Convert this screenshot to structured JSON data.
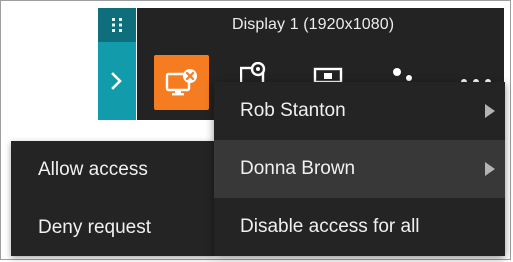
{
  "toolbar": {
    "display_title": "Display 1 (1920x1080)",
    "colors": {
      "bar": "#232323",
      "rail_dark": "#0e6e7c",
      "rail_light": "#129baa",
      "accent": "#f57c20"
    },
    "icons": [
      "drag-handle-icon",
      "expand-chevron-icon",
      "screen-share-blocked-icon",
      "settings-icon",
      "screen-icon",
      "users-icon",
      "more-icon"
    ]
  },
  "submenu": {
    "items": [
      {
        "label": "Allow access"
      },
      {
        "label": "Deny request"
      }
    ]
  },
  "menu": {
    "items": [
      {
        "label": "Rob Stanton",
        "has_submenu": true
      },
      {
        "label": "Donna Brown",
        "has_submenu": true
      },
      {
        "label": "Disable access for all",
        "has_submenu": false
      }
    ]
  }
}
